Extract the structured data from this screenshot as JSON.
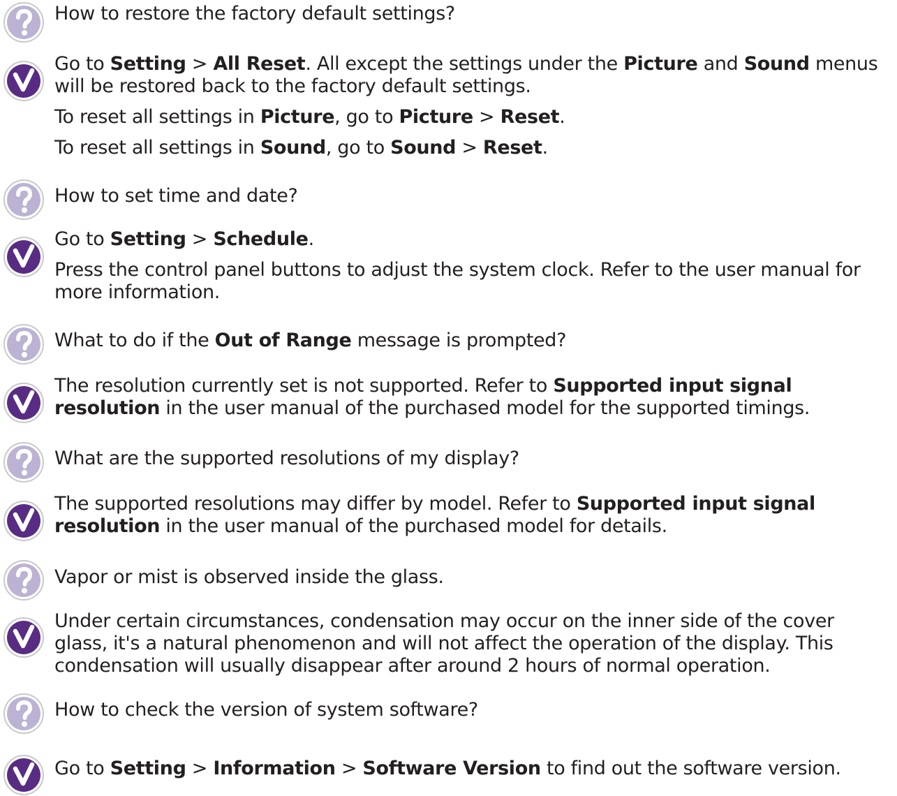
{
  "colors": {
    "question_badge": "#bcb2d3",
    "answer_badge": "#582c83",
    "text": "#231f20"
  },
  "icons": {
    "question": "question-mark-icon",
    "answer": "checkmark-icon"
  },
  "faq": [
    {
      "question": [
        [
          {
            "t": "How to restore the factory default settings?"
          }
        ]
      ],
      "answer": [
        [
          {
            "t": "Go to "
          },
          {
            "t": "Setting",
            "b": true
          },
          {
            "t": " > "
          },
          {
            "t": "All Reset",
            "b": true
          },
          {
            "t": ". All except the settings under the "
          },
          {
            "t": "Picture",
            "b": true
          },
          {
            "t": " and "
          },
          {
            "t": "Sound",
            "b": true
          },
          {
            "t": " menus will be restored back to the factory default settings."
          }
        ],
        [
          {
            "t": "To reset all settings in "
          },
          {
            "t": "Picture",
            "b": true
          },
          {
            "t": ", go to "
          },
          {
            "t": "Picture",
            "b": true
          },
          {
            "t": " > "
          },
          {
            "t": "Reset",
            "b": true
          },
          {
            "t": "."
          }
        ],
        [
          {
            "t": "To reset all settings in "
          },
          {
            "t": "Sound",
            "b": true
          },
          {
            "t": ", go to "
          },
          {
            "t": "Sound",
            "b": true
          },
          {
            "t": " > "
          },
          {
            "t": "Reset",
            "b": true
          },
          {
            "t": "."
          }
        ]
      ]
    },
    {
      "question": [
        [
          {
            "t": "How to set time and date?"
          }
        ]
      ],
      "answer": [
        [
          {
            "t": "Go to "
          },
          {
            "t": "Setting",
            "b": true
          },
          {
            "t": " > "
          },
          {
            "t": "Schedule",
            "b": true
          },
          {
            "t": "."
          }
        ],
        [
          {
            "t": "Press the control panel buttons to adjust the system clock. Refer to the user manual for more information."
          }
        ]
      ]
    },
    {
      "question": [
        [
          {
            "t": "What to do if the "
          },
          {
            "t": "Out of Range",
            "b": true
          },
          {
            "t": " message is prompted?"
          }
        ]
      ],
      "answer": [
        [
          {
            "t": "The resolution currently set is not supported. Refer to "
          },
          {
            "t": "Supported input signal resolution",
            "b": true
          },
          {
            "t": " in the user manual of the purchased model for the supported timings."
          }
        ]
      ]
    },
    {
      "question": [
        [
          {
            "t": "What are the supported resolutions of my display?"
          }
        ]
      ],
      "answer": [
        [
          {
            "t": "The supported resolutions may differ by model. Refer to "
          },
          {
            "t": "Supported input signal resolution",
            "b": true
          },
          {
            "t": " in the user manual of the purchased model for details."
          }
        ]
      ]
    },
    {
      "question": [
        [
          {
            "t": "Vapor or mist is observed inside the glass."
          }
        ]
      ],
      "answer": [
        [
          {
            "t": "Under certain circumstances, condensation may occur on the inner side of the cover glass, it's a natural phenomenon and will not affect the operation of the display. This condensation will usually disappear after around 2 hours of normal operation."
          }
        ]
      ]
    },
    {
      "question": [
        [
          {
            "t": "How to check the version of system software?"
          }
        ]
      ],
      "answer": [
        [
          {
            "t": "Go to "
          },
          {
            "t": "Setting",
            "b": true
          },
          {
            "t": " > "
          },
          {
            "t": "Information",
            "b": true
          },
          {
            "t": " > "
          },
          {
            "t": "Software Version",
            "b": true
          },
          {
            "t": " to find out the software version."
          }
        ]
      ]
    }
  ]
}
